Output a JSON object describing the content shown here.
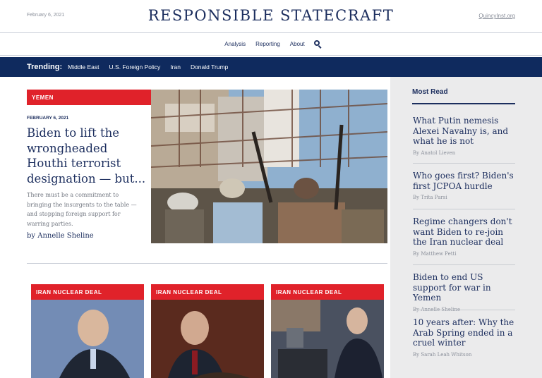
{
  "header": {
    "date": "February 6, 2021",
    "logo": "RESPONSIBLE STATECRAFT",
    "site_link": "QuincyInst.org"
  },
  "nav": {
    "items": [
      "Analysis",
      "Reporting",
      "About"
    ]
  },
  "trending": {
    "label": "Trending:",
    "items": [
      "Middle East",
      "U.S. Foreign Policy",
      "Iran",
      "Donald Trump"
    ]
  },
  "featured": {
    "tag": "YEMEN",
    "date": "FEBRUARY 6, 2021",
    "title": "Biden to lift the wrongheaded Houthi terrorist designation — but...",
    "excerpt": "There must be a commitment to bringing the insurgents to the table — and stopping foreign support for warring parties.",
    "byline": "by Annelle Sheline",
    "image_icon": "photo-yemen-fighters"
  },
  "cards": [
    {
      "tag": "IRAN NUCLEAR DEAL"
    },
    {
      "tag": "IRAN NUCLEAR DEAL"
    },
    {
      "tag": "IRAN NUCLEAR DEAL"
    }
  ],
  "most_read": {
    "title": "Most Read",
    "items": [
      {
        "title": "What Putin nemesis Alexei Navalny is, and what he is not",
        "by": "By",
        "author": "Anatol Lieven"
      },
      {
        "title": "Who goes first? Biden's first JCPOA hurdle",
        "by": "By",
        "author": "Trita Parsi"
      },
      {
        "title": "Regime changers don't want Biden to re-join the Iran nuclear deal",
        "by": "By",
        "author": "Matthew Petti"
      },
      {
        "title": "Biden to end US support for war in Yemen",
        "by": "By",
        "author": "Annelle Sheline"
      },
      {
        "title": "10 years after: Why the Arab Spring ended in a cruel winter",
        "by": "By",
        "author": "Sarah Leah Whitson"
      }
    ]
  },
  "colors": {
    "navy": "#0f2a5e",
    "tag_red": "#e0222a",
    "sidebar_bg": "#ebebec"
  }
}
